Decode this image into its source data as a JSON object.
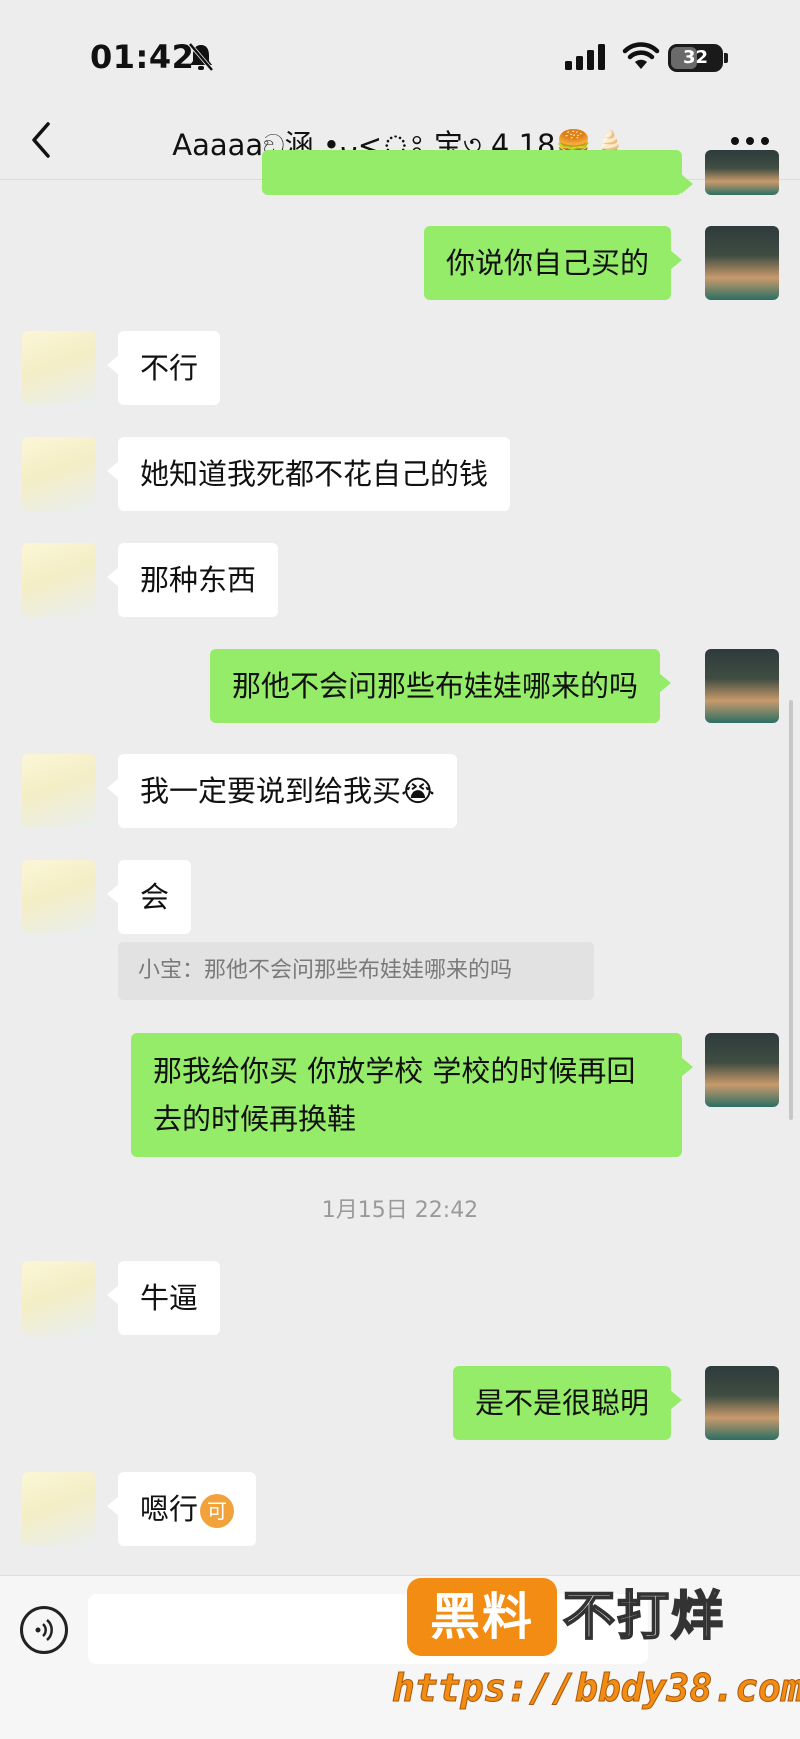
{
  "status_bar": {
    "time": "01:42",
    "battery": "32"
  },
  "nav": {
    "title": "Aaaaaඞ涵 •ᴗ<ঃ 宝৩ 4.18🍔🍦"
  },
  "messages": [
    {
      "side": "left",
      "text": "不行"
    },
    {
      "side": "left",
      "text": "她知道我死都不花自己的钱"
    },
    {
      "side": "left",
      "text": "那种东西"
    },
    {
      "side": "right",
      "text": "那他不会问那些布娃娃哪来的吗"
    },
    {
      "side": "left",
      "text": "我一定要说到给我买😭"
    },
    {
      "side": "left",
      "text": "会"
    },
    {
      "side": "right",
      "text": "那我给你买 你放学校 学校的时候再回去的时候再换鞋"
    },
    {
      "side": "left",
      "text": "牛逼"
    },
    {
      "side": "right",
      "text": "是不是很聪明"
    },
    {
      "side": "left",
      "text": "嗯行"
    }
  ],
  "top_right_message": "你说你自己买的",
  "quote": "小宝：那他不会问那些布娃娃哪来的吗",
  "timestamp": "1月15日 22:42",
  "emoji_badge": "可",
  "watermark": {
    "brand": "黑料",
    "slogan": "不打烊",
    "url": "https://bbdy38.com"
  },
  "colors": {
    "bubble_self": "#95ec69",
    "bubble_other": "#ffffff",
    "background": "#ededed",
    "watermark": "#f28c12"
  }
}
